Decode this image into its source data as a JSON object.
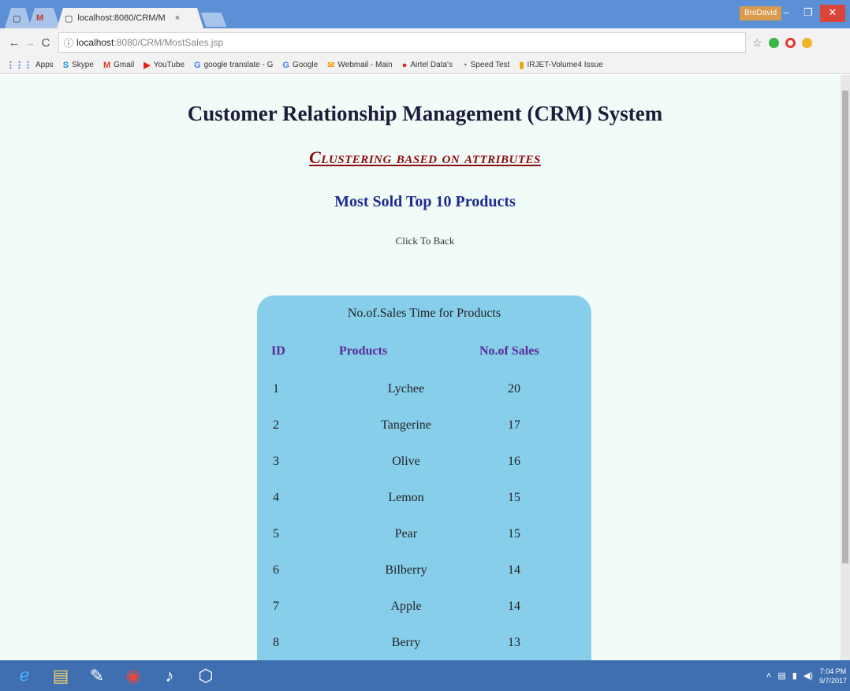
{
  "browser": {
    "tabs": [
      {
        "label": "",
        "icon": "page-icon"
      },
      {
        "label": "M",
        "icon": "gmail-icon"
      },
      {
        "label": "localhost:8080/CRM/M",
        "icon": "page-icon"
      }
    ],
    "active_tab_close": "×",
    "window_user": "BroDavid",
    "address": {
      "host": "localhost",
      "path": ":8080/CRM/MostSales.jsp"
    },
    "bookmarks": [
      "Apps",
      "Skype",
      "Gmail",
      "YouTube",
      "google translate - G",
      "Google",
      "Webmail - Main",
      "Airtel Data's",
      "Speed Test",
      "IRJET-Volume4 Issue"
    ]
  },
  "page": {
    "title": "Customer Relationship Management (CRM) System",
    "section": "Clustering based on attributes",
    "subtitle": "Most Sold Top 10 Products",
    "back_link": "Click To Back",
    "background": "#f1fbf8"
  },
  "sales_table": {
    "caption": "No.of.Sales Time for Products",
    "headers": [
      "ID",
      "Products",
      "No.of Sales"
    ],
    "rows": [
      [
        "1",
        "Lychee",
        "20"
      ],
      [
        "2",
        "Tangerine",
        "17"
      ],
      [
        "3",
        "Olive",
        "16"
      ],
      [
        "4",
        "Lemon",
        "15"
      ],
      [
        "5",
        "Pear",
        "15"
      ],
      [
        "6",
        "Bilberry",
        "14"
      ],
      [
        "7",
        "Apple",
        "14"
      ],
      [
        "8",
        "Berry",
        "13"
      ]
    ],
    "card_color": "#87ceeb",
    "header_color": "#5a2a9a"
  },
  "taskbar": {
    "apps": [
      "internet-explorer-icon",
      "file-explorer-icon",
      "paint-icon",
      "chrome-icon",
      "media-icon",
      "security-icon"
    ],
    "clock_time": "7:04 PM",
    "clock_date": "9/7/2017"
  }
}
